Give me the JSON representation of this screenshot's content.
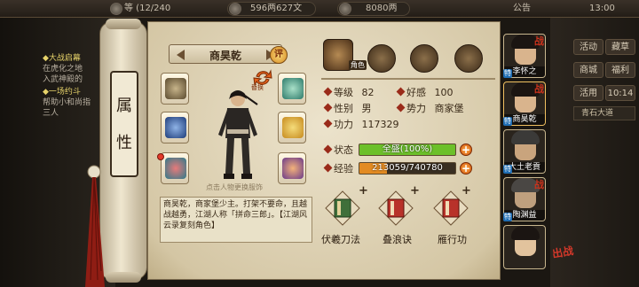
{
  "topbar": {
    "level_text": "等 (12/240",
    "money": "596两627文",
    "gold": "8080两",
    "notice": "公告",
    "time": "13:00"
  },
  "quests": [
    {
      "title": "大战启幕",
      "lines": [
        "在虎化之地",
        "入武神殿的"
      ]
    },
    {
      "title": "一场约斗",
      "lines": [
        "帮助小和尚指",
        "三人"
      ]
    }
  ],
  "right_buttons": [
    "活动",
    "藏草",
    "商城",
    "福利",
    "活用",
    "10:14"
  ],
  "right_banner": "青石大道",
  "scroll": {
    "attr_label_1": "属",
    "attr_label_2": "性"
  },
  "character": {
    "name": "商昊乾",
    "eval_label": "评",
    "swap_label": "替换",
    "hint": "点击人物更换服饰",
    "description": "商昊乾，商家堡少主。打架不要命，且越战越勇，江湖人称「拼命三郎」。【江湖风云录复刻角色】"
  },
  "categories": [
    {
      "icon": "character-tab-icon",
      "badge": "角色"
    },
    {
      "icon": "scroll-tab-icon"
    },
    {
      "icon": "taiji-tab-icon"
    },
    {
      "icon": "meridian-tab-icon"
    }
  ],
  "stats": {
    "level_label": "等级",
    "level": "82",
    "favor_label": "好感",
    "favor": "100",
    "gender_label": "性别",
    "gender": "男",
    "faction_label": "势力",
    "faction": "商家堡",
    "power_label": "功力",
    "power": "117329",
    "status_label": "状态",
    "status_text": "全盛(100%)",
    "status_fill": 1.0,
    "exp_label": "经验",
    "exp_text": "213059/740780",
    "exp_fill": 0.29
  },
  "skills": [
    {
      "name": "伏羲刀法"
    },
    {
      "name": "叠浪诀"
    },
    {
      "name": "雁行功"
    }
  ],
  "roster": [
    {
      "name": "李怀之",
      "badge": "特"
    },
    {
      "name": "商昊乾",
      "badge": "特"
    },
    {
      "name": "大土老貢",
      "badge": "特"
    },
    {
      "name": "陶渊益",
      "badge": "特"
    },
    {
      "name": "",
      "badge": ""
    }
  ],
  "roster_mark": "战",
  "colors": {
    "status_green": "#6cc02a",
    "exp_orange": "#e38b22",
    "accent_red": "#c8321c"
  }
}
